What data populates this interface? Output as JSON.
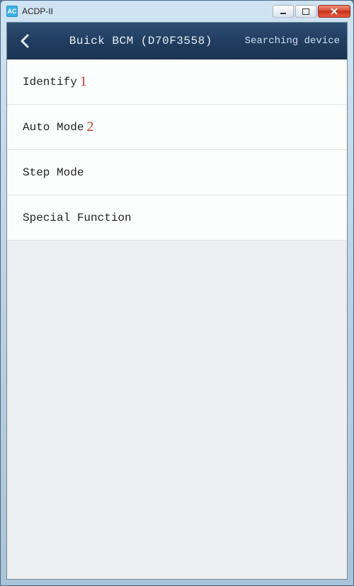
{
  "window": {
    "title": "ACDP-II",
    "icon_text": "AC"
  },
  "header": {
    "title": "Buick BCM (D70F3558)",
    "status": "Searching device"
  },
  "menu": {
    "items": [
      {
        "label": "Identify",
        "annotation": "1"
      },
      {
        "label": "Auto Mode",
        "annotation": "2"
      },
      {
        "label": "Step Mode",
        "annotation": ""
      },
      {
        "label": "Special Function",
        "annotation": ""
      }
    ]
  }
}
